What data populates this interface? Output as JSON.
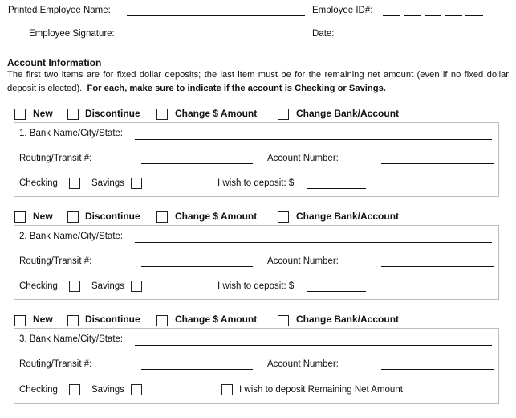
{
  "header": {
    "printed_name_label": "Printed Employee Name:",
    "employee_id_label": "Employee ID#:",
    "signature_label": "Employee Signature:",
    "date_label": "Date:"
  },
  "account_info": {
    "heading": "Account Information",
    "instructions_regular": "The first two items are for fixed dollar deposits; the last item must be for the remaining net amount (even if no fixed dollar deposit is elected).",
    "instructions_bold": "For each, make sure to indicate if the account is Checking or Savings."
  },
  "actions": [
    "New",
    "Discontinue",
    "Change $ Amount",
    "Change Bank/Account"
  ],
  "accounts": [
    {
      "bank_label": "1. Bank Name/City/State:",
      "routing_label": "Routing/Transit #:",
      "account_number_label": "Account Number:",
      "checking_label": "Checking",
      "savings_label": "Savings",
      "deposit_label": "I wish to deposit:  $"
    },
    {
      "bank_label": "2. Bank Name/City/State:",
      "routing_label": "Routing/Transit #:",
      "account_number_label": "Account Number:",
      "checking_label": "Checking",
      "savings_label": "Savings",
      "deposit_label": "I wish to deposit:  $"
    },
    {
      "bank_label": "3. Bank Name/City/State:",
      "routing_label": "Routing/Transit #:",
      "account_number_label": "Account Number:",
      "checking_label": "Checking",
      "savings_label": "Savings",
      "deposit_label": "I wish to deposit Remaining Net Amount"
    }
  ]
}
